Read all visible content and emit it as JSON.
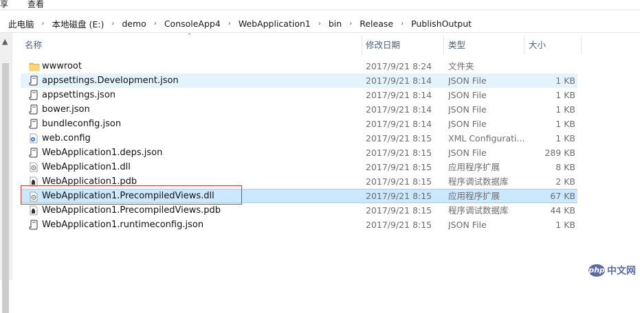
{
  "ribbon": {
    "share_tab": "享",
    "view_tab": "查看"
  },
  "breadcrumb": [
    "此电脑",
    "本地磁盘 (E:)",
    "demo",
    "ConsoleApp4",
    "WebApplication1",
    "bin",
    "Release",
    "PublishOutput"
  ],
  "columns": {
    "name": "名称",
    "date": "修改日期",
    "type": "类型",
    "size": "大小"
  },
  "files": [
    {
      "name": "wwwroot",
      "date": "2017/9/21 8:24",
      "type": "文件夹",
      "size": "",
      "icon": "folder-icon"
    },
    {
      "name": "appsettings.Development.json",
      "date": "2017/9/21 8:14",
      "type": "JSON File",
      "size": "1 KB",
      "icon": "json-file-icon"
    },
    {
      "name": "appsettings.json",
      "date": "2017/9/21 8:14",
      "type": "JSON File",
      "size": "1 KB",
      "icon": "json-file-icon"
    },
    {
      "name": "bower.json",
      "date": "2017/9/21 8:14",
      "type": "JSON File",
      "size": "1 KB",
      "icon": "json-file-icon"
    },
    {
      "name": "bundleconfig.json",
      "date": "2017/9/21 8:14",
      "type": "JSON File",
      "size": "1 KB",
      "icon": "json-file-icon"
    },
    {
      "name": "web.config",
      "date": "2017/9/21 8:15",
      "type": "XML Configurati...",
      "size": "1 KB",
      "icon": "config-file-icon"
    },
    {
      "name": "WebApplication1.deps.json",
      "date": "2017/9/21 8:15",
      "type": "JSON File",
      "size": "289 KB",
      "icon": "json-file-icon"
    },
    {
      "name": "WebApplication1.dll",
      "date": "2017/9/21 8:15",
      "type": "应用程序扩展",
      "size": "8 KB",
      "icon": "dll-file-icon"
    },
    {
      "name": "WebApplication1.pdb",
      "date": "2017/9/21 8:15",
      "type": "程序调试数据库",
      "size": "2 KB",
      "icon": "pdb-file-icon"
    },
    {
      "name": "WebApplication1.PrecompiledViews.dll",
      "date": "2017/9/21 8:15",
      "type": "应用程序扩展",
      "size": "67 KB",
      "icon": "dll-file-icon"
    },
    {
      "name": "WebApplication1.PrecompiledViews.pdb",
      "date": "2017/9/21 8:15",
      "type": "程序调试数据库",
      "size": "44 KB",
      "icon": "pdb-file-icon"
    },
    {
      "name": "WebApplication1.runtimeconfig.json",
      "date": "2017/9/21 8:15",
      "type": "JSON File",
      "size": "1 KB",
      "icon": "json-file-icon"
    }
  ],
  "state": {
    "hover_row": 1,
    "selected_row": 9
  },
  "watermark": {
    "logo": "php",
    "text": "中文网"
  },
  "colors": {
    "selected_bg": "#cce8ff",
    "hover_bg": "#e5f3ff",
    "highlight_border": "#e0322d",
    "folder": "#f4cc5c"
  }
}
